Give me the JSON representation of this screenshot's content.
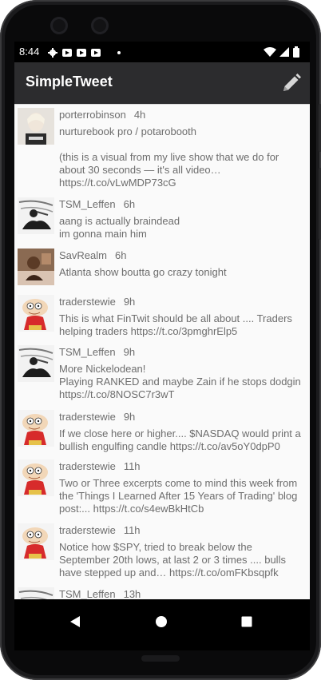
{
  "status_bar": {
    "time": "8:44",
    "left_icons": [
      "gear-icon",
      "youtube-icon",
      "youtube-icon",
      "youtube-icon",
      "dot-icon"
    ],
    "right_icons": [
      "wifi-icon",
      "signal-icon",
      "battery-icon"
    ]
  },
  "app_bar": {
    "title": "SimpleTweet",
    "compose_icon": "pencil-icon",
    "background": "#2c2c2e"
  },
  "tweets": [
    {
      "handle": "porterrobinson",
      "time": "4h",
      "text": "nurturebook pro / potarobooth\n\n(this is a visual from my live show that we do for about 30 seconds — it's all video… https://t.co/vLwMDP73cG",
      "avatar": "avatar-porterrobinson"
    },
    {
      "handle": "TSM_Leffen",
      "time": "6h",
      "text": "aang is actually braindead\nim gonna main him",
      "avatar": "avatar-tsm-leffen"
    },
    {
      "handle": "SavRealm",
      "time": "6h",
      "text": "Atlanta show boutta go crazy tonight",
      "avatar": "avatar-savrealm"
    },
    {
      "handle": "traderstewie",
      "time": "9h",
      "text": "This is what FinTwit should be all about .... Traders helping traders https://t.co/3pmghrElp5",
      "avatar": "avatar-traderstewie"
    },
    {
      "handle": "TSM_Leffen",
      "time": "9h",
      "text": "More Nickelodean!\nPlaying RANKED and maybe Zain if he stops dodgin https://t.co/8NOSC7r3wT",
      "avatar": "avatar-tsm-leffen"
    },
    {
      "handle": "traderstewie",
      "time": "9h",
      "text": "If we close here or higher.... $NASDAQ would print a bullish engulfing candle https://t.co/av5oY0dpP0",
      "avatar": "avatar-traderstewie"
    },
    {
      "handle": "traderstewie",
      "time": "11h",
      "text": "Two or Three excerpts come to mind this week from the 'Things I Learned After 15 Years of Trading' blog post:... https://t.co/s4ewBkHtCb",
      "avatar": "avatar-traderstewie"
    },
    {
      "handle": "traderstewie",
      "time": "11h",
      "text": "Notice how $SPY, tried to break below the September 20th lows, at last 2 or 3 times .... bulls have stepped up and… https://t.co/omFKbsqpfk",
      "avatar": "avatar-traderstewie"
    },
    {
      "handle": "TSM_Leffen",
      "time": "13h",
      "text": "",
      "avatar": "avatar-tsm-leffen"
    }
  ],
  "nav_bar": {
    "back_icon": "back-triangle-icon",
    "home_icon": "home-circle-icon",
    "recents_icon": "recents-square-icon"
  },
  "colors": {
    "feed_background": "#fafafa",
    "text_gray": "#6d6d6d",
    "app_bar": "#2c2c2e",
    "title_text": "#ffffff"
  }
}
